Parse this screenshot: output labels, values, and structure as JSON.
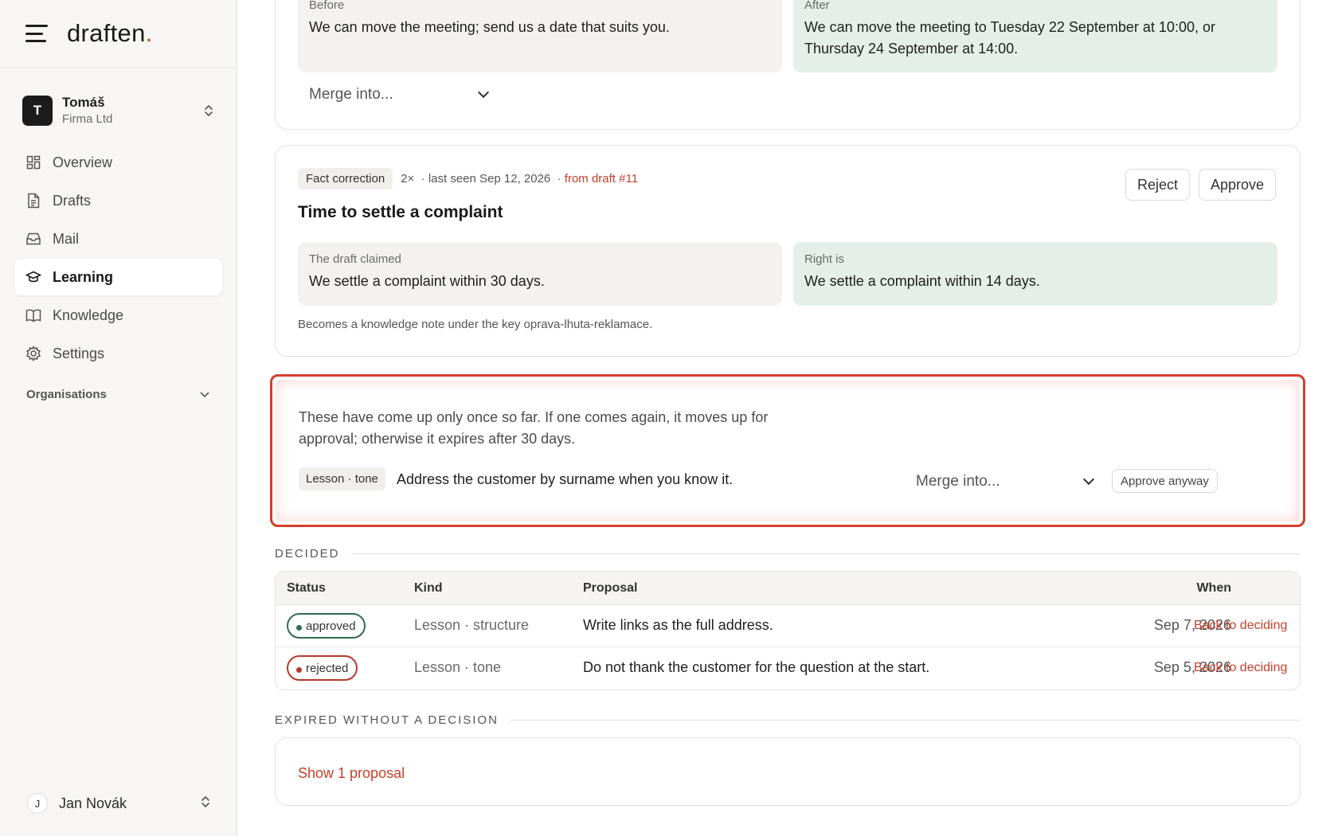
{
  "brand": {
    "name": "draften",
    "dot": "."
  },
  "account": {
    "initial": "T",
    "name": "Tomáš",
    "org": "Firma Ltd"
  },
  "nav": [
    {
      "label": "Overview",
      "icon": "grid-icon"
    },
    {
      "label": "Drafts",
      "icon": "document-icon"
    },
    {
      "label": "Mail",
      "icon": "inbox-icon"
    },
    {
      "label": "Learning",
      "icon": "graduation-cap-icon",
      "active": true
    },
    {
      "label": "Knowledge",
      "icon": "book-icon"
    },
    {
      "label": "Settings",
      "icon": "gear-icon"
    }
  ],
  "organisations_label": "Organisations",
  "user": {
    "initial": "J",
    "name": "Jan Novák"
  },
  "card1": {
    "before_label": "Before",
    "before_text": "We can move the meeting; send us a date that suits you.",
    "after_label": "After",
    "after_text": "We can move the meeting to Tuesday 22 September at 10:00, or Thursday 24 September at 14:00.",
    "merge_placeholder": "Merge into..."
  },
  "card2": {
    "tag": "Fact correction",
    "count": "2×",
    "last_seen": "· last seen Sep 12, 2026",
    "source": "· from draft #11",
    "title": "Time to settle a complaint",
    "reject": "Reject",
    "approve": "Approve",
    "claimed_label": "The draft claimed",
    "claimed_text": "We settle a complaint within 30 days.",
    "right_label": "Right is",
    "right_text": "We settle a complaint within 14 days.",
    "note": "Becomes a knowledge note under the key oprava-lhuta-reklamace."
  },
  "card_once": {
    "text": "These have come up only once so far. If one comes again, it moves up for approval; otherwise it expires after 30 days.",
    "lesson_tag": "Lesson · tone",
    "lesson_text": "Address the customer by surname when you know it.",
    "merge_placeholder": "Merge into...",
    "approve_anyway": "Approve anyway"
  },
  "decided": {
    "heading": "DECIDED",
    "columns": {
      "status": "Status",
      "kind": "Kind",
      "proposal": "Proposal",
      "when": "When"
    },
    "rows": [
      {
        "status": "approved",
        "kind": "Lesson · structure",
        "proposal": "Write links as the full address.",
        "when": "Sep 7, 2026",
        "action": "Back to deciding"
      },
      {
        "status": "rejected",
        "kind": "Lesson · tone",
        "proposal": "Do not thank the customer for the question at the start.",
        "when": "Sep 5, 2026",
        "action": "Back to deciding"
      }
    ]
  },
  "expired": {
    "heading": "EXPIRED WITHOUT A DECISION",
    "link": "Show 1 proposal"
  },
  "colors": {
    "accent": "#c4412c",
    "approved": "#2f6b4f",
    "rejected": "#b7382a",
    "highlight": "#d63d2a"
  }
}
